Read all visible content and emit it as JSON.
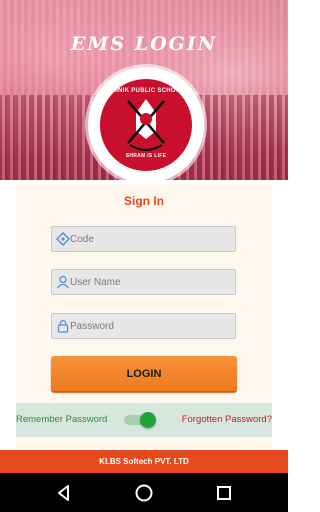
{
  "header": {
    "title": "EMS LOGIN"
  },
  "logo": {
    "top_text": "SAINIK PUBLIC SCHOOL",
    "bottom_text": "SHRAM IS LIFE"
  },
  "form": {
    "heading": "Sign In",
    "code_placeholder": "Code",
    "username_placeholder": "User Name",
    "password_placeholder": "Password",
    "login_label": "LOGIN"
  },
  "options": {
    "remember_label": "Remember Password",
    "remember_enabled": true,
    "forgot_label": "Forgotten Password?"
  },
  "footer": {
    "text": "KLBS Softech PVT. LTD"
  },
  "colors": {
    "accent": "#e8481c",
    "button": "#ef7a1f",
    "toggle_on": "#21a338"
  },
  "icons": [
    "code-icon",
    "user-icon",
    "lock-icon",
    "back-icon",
    "home-icon",
    "recents-icon"
  ]
}
